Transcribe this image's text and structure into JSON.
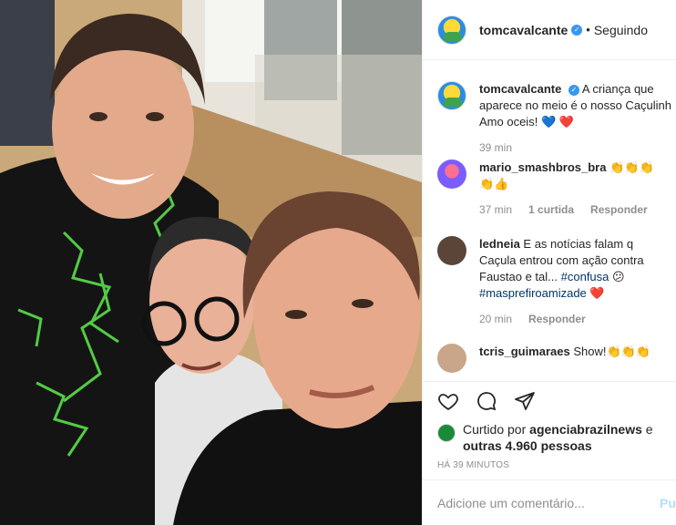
{
  "header": {
    "username": "tomcavalcante",
    "separator": "•",
    "follow_status": "Seguindo"
  },
  "caption": {
    "username": "tomcavalcante",
    "text": "A criança que aparece no meio é o nosso Caçulinha.",
    "text_line1": "A criança que",
    "text_line2": "aparece no meio é o nosso Caçulinh",
    "text_line3": "Amo oceis!",
    "emoji": "💙 ❤️",
    "time": "39 min"
  },
  "comments": [
    {
      "username": "mario_smashbros_bra",
      "text_line1": "👏👏👏",
      "text_line2": "👏👍",
      "time": "37 min",
      "likes": "1 curtida",
      "reply": "Responder"
    },
    {
      "username": "ledneia",
      "text_line1": "E as notícias falam q",
      "text_line2": "Caçula entrou com ação contra",
      "text_line3": "Faustao e tal...",
      "tag1": "#confusa",
      "emoji1": "😕",
      "tag2": "#masprefiroamizade",
      "emoji2": "❤️",
      "time": "20 min",
      "reply": "Responder"
    },
    {
      "username": "tcris_guimaraes",
      "text": "Show!👏👏👏"
    }
  ],
  "actions": {
    "like_icon": "heart-outline-icon",
    "comment_icon": "speech-bubble-icon",
    "share_icon": "paper-plane-icon"
  },
  "likes": {
    "prefix": "Curtido por",
    "user": "agenciabrazilnews",
    "connector": "e",
    "others": "outras 4.960 pessoas"
  },
  "timestamp": "HÁ 39 MINUTOS",
  "add_comment": {
    "placeholder": "Adicione um comentário...",
    "publish": "Pu"
  },
  "colors": {
    "link_blue": "#003569",
    "verified_blue": "#3897f0",
    "muted": "#8e8e8e",
    "heart_red": "#ed4956"
  }
}
